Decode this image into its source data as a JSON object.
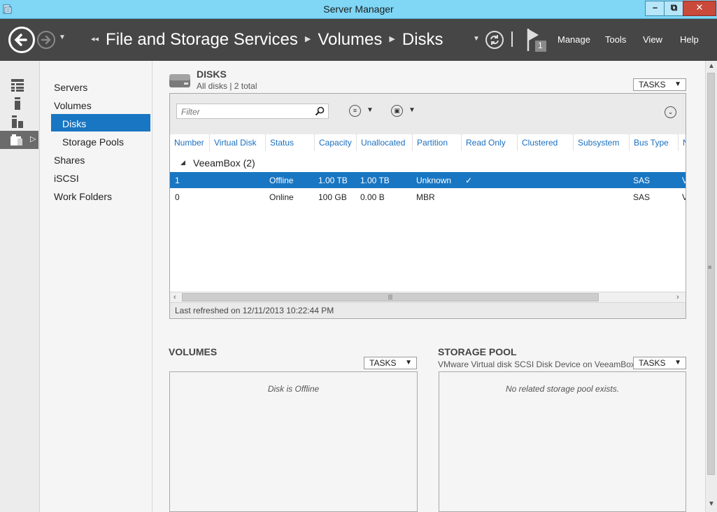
{
  "window": {
    "title": "Server Manager",
    "minimize_label": "–",
    "maximize_label": "⧉",
    "close_label": "✕"
  },
  "header": {
    "breadcrumb": [
      "File and Storage Services",
      "Volumes",
      "Disks"
    ],
    "notification_count": "1",
    "menu": [
      "Manage",
      "Tools",
      "View",
      "Help"
    ]
  },
  "nav": {
    "items": [
      "Servers",
      "Volumes",
      "Disks",
      "Storage Pools",
      "Shares",
      "iSCSI",
      "Work Folders"
    ],
    "selected": "Disks"
  },
  "disks": {
    "title": "DISKS",
    "subtitle": "All disks | 2 total",
    "tasks_label": "TASKS",
    "filter_placeholder": "Filter",
    "columns": [
      "Number",
      "Virtual Disk",
      "Status",
      "Capacity",
      "Unallocated",
      "Partition",
      "Read Only",
      "Clustered",
      "Subsystem",
      "Bus Type",
      "N"
    ],
    "group_label": "VeeamBox (2)",
    "rows": [
      {
        "number": "1",
        "virtual_disk": "",
        "status": "Offline",
        "capacity": "1.00 TB",
        "unallocated": "1.00 TB",
        "partition": "Unknown",
        "read_only": "✓",
        "clustered": "",
        "subsystem": "",
        "bus_type": "SAS",
        "name": "V",
        "selected": true
      },
      {
        "number": "0",
        "virtual_disk": "",
        "status": "Online",
        "capacity": "100 GB",
        "unallocated": "0.00 B",
        "partition": "MBR",
        "read_only": "",
        "clustered": "",
        "subsystem": "",
        "bus_type": "SAS",
        "name": "V",
        "selected": false
      }
    ],
    "last_refreshed": "Last refreshed on 12/11/2013 10:22:44 PM"
  },
  "volumes": {
    "title": "VOLUMES",
    "tasks_label": "TASKS",
    "message": "Disk is Offline"
  },
  "storage_pool": {
    "title": "STORAGE POOL",
    "subtitle": "VMware Virtual disk SCSI Disk Device on VeeamBox",
    "tasks_label": "TASKS",
    "message": "No related storage pool exists."
  },
  "colors": {
    "titlebar": "#7fd6f5",
    "header": "#464646",
    "selection": "#1976c2",
    "column_header_text": "#1a6fbf"
  }
}
